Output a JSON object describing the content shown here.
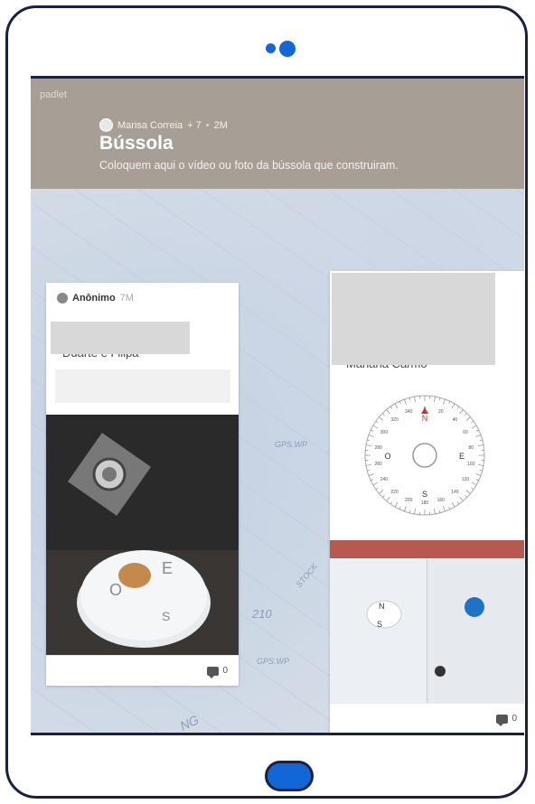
{
  "padlet": {
    "brand": "padlet",
    "author": "Marisa Correia",
    "contributors": "+ 7",
    "separator": "•",
    "age": "2M",
    "title": "Bússola",
    "description": "Coloquem aqui o vídeo ou foto da bússola que construiram."
  },
  "map_labels": [
    "GPS.WP",
    "210",
    "STOCK",
    "GPS.WP",
    "NG"
  ],
  "posts": [
    {
      "author": "Anônimo",
      "time": "7M",
      "title_partial": "Duarte e Filipa",
      "comments": "0"
    },
    {
      "title_partial": "Mariana Carmo",
      "comments": "0",
      "compass": {
        "north": "N",
        "south": "S",
        "east": "E",
        "west": "O",
        "degrees": [
          "0",
          "20",
          "40",
          "60",
          "80",
          "100",
          "120",
          "140",
          "160",
          "180",
          "200",
          "220",
          "240",
          "260",
          "280",
          "300",
          "320",
          "340"
        ]
      }
    }
  ],
  "colors": {
    "frame": "#1a2140",
    "accent": "#1366d6",
    "header": "#a79e96"
  }
}
